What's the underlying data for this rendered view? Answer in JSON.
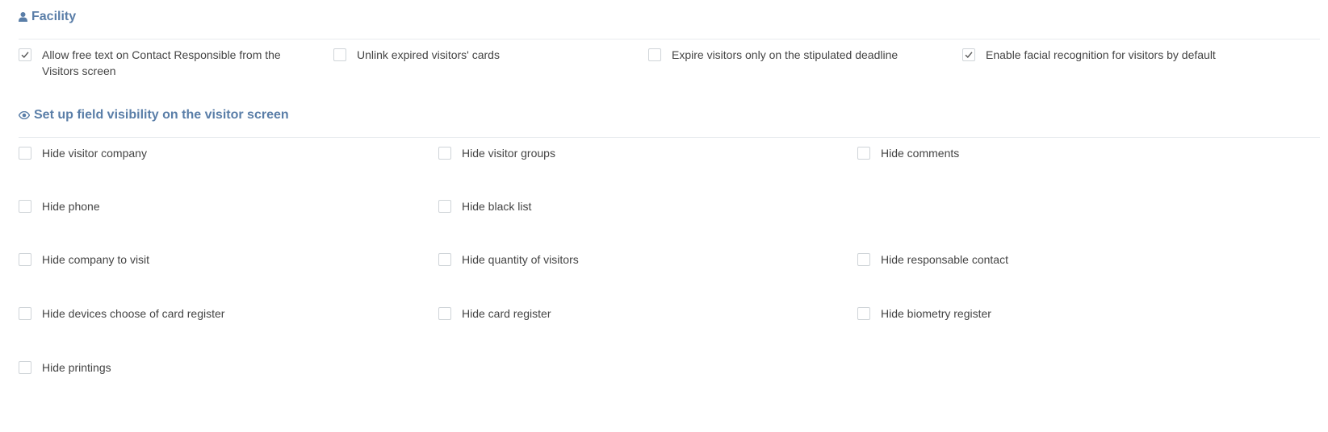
{
  "facility": {
    "title": "Facility",
    "icon": "user-icon",
    "options": [
      {
        "label": "Allow free text on Contact Responsible from the Visitors screen",
        "checked": true
      },
      {
        "label": "Unlink expired visitors' cards",
        "checked": false
      },
      {
        "label": "Expire visitors only on the stipulated deadline",
        "checked": false
      },
      {
        "label": "Enable facial recognition for visitors by default",
        "checked": true
      }
    ]
  },
  "visibility": {
    "title": "Set up field visibility on the visitor screen",
    "icon": "eye-icon",
    "options": [
      {
        "label": "Hide visitor company",
        "checked": false
      },
      {
        "label": "Hide visitor groups",
        "checked": false
      },
      {
        "label": "Hide comments",
        "checked": false
      },
      {
        "label": "Hide phone",
        "checked": false
      },
      {
        "label": "Hide black list",
        "checked": false
      },
      {
        "label": "Hide company to visit",
        "checked": false
      },
      {
        "label": "Hide quantity of visitors",
        "checked": false
      },
      {
        "label": "Hide responsable contact",
        "checked": false
      },
      {
        "label": "Hide devices choose of card register",
        "checked": false
      },
      {
        "label": "Hide card register",
        "checked": false
      },
      {
        "label": "Hide biometry register",
        "checked": false
      },
      {
        "label": "Hide printings",
        "checked": false
      }
    ]
  },
  "colors": {
    "accent": "#5a7ea8",
    "checkbox_border": "#cfd4d8",
    "check": "#555555"
  }
}
